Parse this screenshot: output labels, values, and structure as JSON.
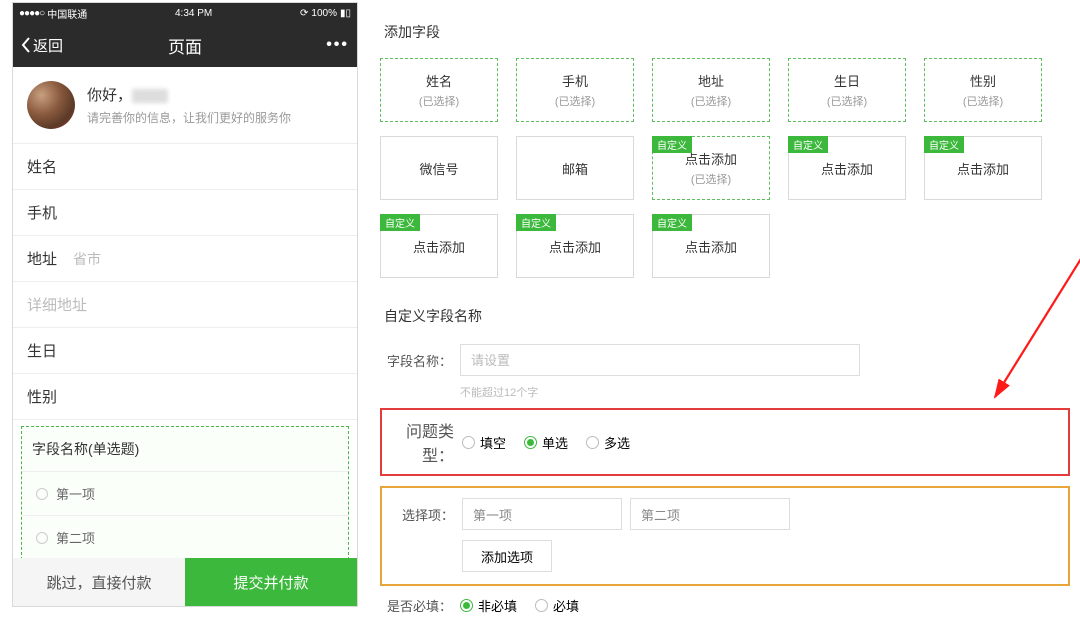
{
  "phone": {
    "status": {
      "carrier": "中国联通",
      "time": "4:34 PM",
      "battery": "100%"
    },
    "nav": {
      "back": "返回",
      "title": "页面",
      "more": "•••"
    },
    "profile": {
      "hello_prefix": "你好，",
      "sub": "请完善你的信息，让我们更好的服务你"
    },
    "rows": {
      "name_label": "姓名",
      "phone_label": "手机",
      "address_label": "地址",
      "address_ph": "省市",
      "detail_ph": "详细地址",
      "birthday_label": "生日",
      "gender_label": "性别"
    },
    "field_group": {
      "title": "字段名称(单选题)",
      "opt1": "第一项",
      "opt2": "第二项"
    },
    "footer": {
      "skip": "跳过，直接付款",
      "submit": "提交并付款"
    }
  },
  "config": {
    "add_section_title": "添加字段",
    "selected_tag": "(已选择)",
    "custom_badge": "自定义",
    "click_add": "点击添加",
    "fields": {
      "name": "姓名",
      "phone": "手机",
      "address": "地址",
      "birthday": "生日",
      "gender": "性别",
      "wechat": "微信号",
      "email": "邮箱"
    },
    "custom_panel": {
      "title": "自定义字段名称",
      "name_label": "字段名称：",
      "name_placeholder": "请设置",
      "name_hint": "不能超过12个字",
      "qtype_label": "问题类型：",
      "qtype_fill": "填空",
      "qtype_single": "单选",
      "qtype_multi": "多选",
      "opts_label": "选择项：",
      "opt1": "第一项",
      "opt2": "第二项",
      "add_opt": "添加选项",
      "required_label": "是否必填：",
      "required_no": "非必填",
      "required_yes": "必填"
    }
  }
}
